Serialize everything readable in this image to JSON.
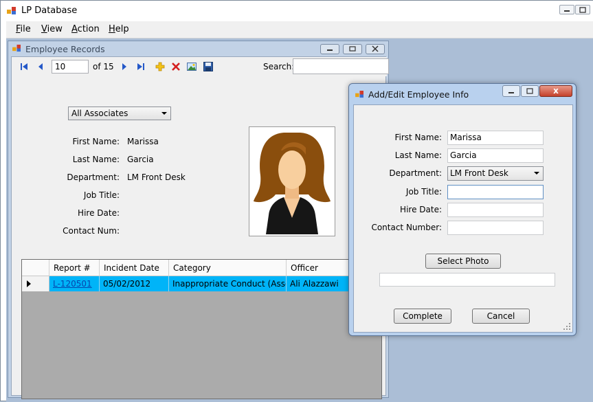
{
  "app": {
    "title": "LP Database"
  },
  "menu": [
    {
      "label": "File",
      "accel": "F",
      "rest": "ile"
    },
    {
      "label": "View",
      "accel": "V",
      "rest": "iew"
    },
    {
      "label": "Action",
      "accel": "A",
      "rest": "ction"
    },
    {
      "label": "Help",
      "accel": "H",
      "rest": "elp"
    }
  ],
  "employee_window": {
    "title": "Employee Records",
    "toolbar": {
      "position_value": "10",
      "of_count": "of 15",
      "search_label": "Search:",
      "search_value": ""
    },
    "filter": {
      "selected": "All Associates"
    },
    "fields": [
      {
        "label": "First Name:",
        "value": "Marissa"
      },
      {
        "label": "Last Name:",
        "value": "Garcia"
      },
      {
        "label": "Department:",
        "value": "LM Front Desk"
      },
      {
        "label": "Job Title:",
        "value": ""
      },
      {
        "label": "Hire Date:",
        "value": ""
      },
      {
        "label": "Contact Num:",
        "value": ""
      }
    ],
    "grid": {
      "columns": [
        "Report #",
        "Incident Date",
        "Category",
        "Officer"
      ],
      "rows": [
        {
          "report": "L-120501",
          "date": "05/02/2012",
          "category": "Inappropriate Conduct (Associate)",
          "officer": "Ali Alazzawi"
        }
      ]
    }
  },
  "dialog": {
    "title": "Add/Edit Employee Info",
    "close_label": "x",
    "fields": [
      {
        "label": "First Name:",
        "value": "Marissa"
      },
      {
        "label": "Last Name:",
        "value": "Garcia"
      },
      {
        "label": "Department:",
        "value": "LM Front Desk"
      },
      {
        "label": "Job Title:",
        "value": ""
      },
      {
        "label": "Hire Date:",
        "value": ""
      },
      {
        "label": "Contact Number:",
        "value": ""
      }
    ],
    "select_photo_label": "Select Photo",
    "photo_path": "",
    "complete_label": "Complete",
    "cancel_label": "Cancel"
  },
  "colors": {
    "selection": "#00b4f8",
    "mdi_background": "#abbed6",
    "close_button": "#c4402a"
  }
}
